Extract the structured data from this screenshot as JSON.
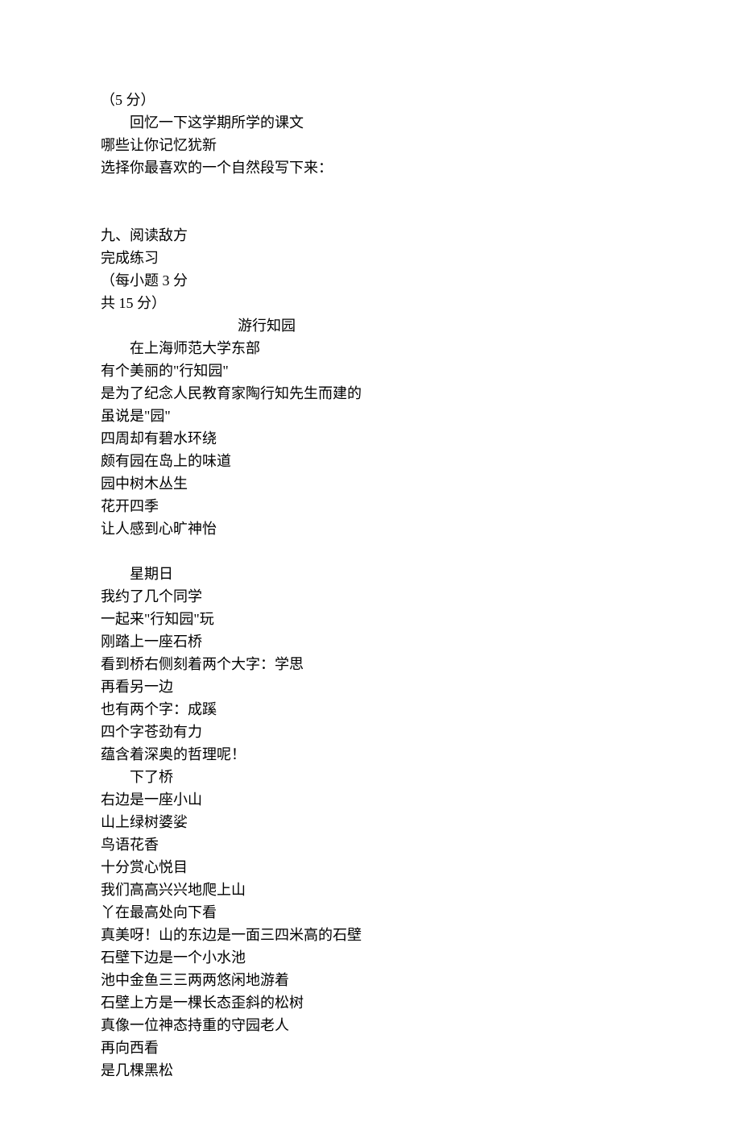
{
  "block1": {
    "l1": "（5 分）",
    "l2": "回忆一下这学期所学的课文",
    "l3": "哪些让你记忆犹新",
    "l4": "选择你最喜欢的一个自然段写下来："
  },
  "block2": {
    "l1": "九、阅读敌方",
    "l2": "完成练习",
    "l3": "（每小题 3 分",
    "l4": "共 15 分）",
    "title": "游行知园",
    "l5": "在上海师范大学东部",
    "l6": "有个美丽的\"行知园\"",
    "l7": "是为了纪念人民教育家陶行知先生而建的",
    "l8": "虽说是\"园\"",
    "l9": "四周却有碧水环绕",
    "l10": "颇有园在岛上的味道",
    "l11": "园中树木丛生",
    "l12": "花开四季",
    "l13": "让人感到心旷神怡"
  },
  "block3": {
    "l1": "星期日",
    "l2": "我约了几个同学",
    "l3": "一起来\"行知园\"玩",
    "l4": "刚踏上一座石桥",
    "l5": "看到桥右侧刻着两个大字：学思",
    "l6": "再看另一边",
    "l7": "也有两个字：成蹊",
    "l8": "四个字苍劲有力",
    "l9": "蕴含着深奥的哲理呢！",
    "l10": "下了桥",
    "l11": "右边是一座小山",
    "l12": "山上绿树婆娑",
    "l13": "鸟语花香",
    "l14": "十分赏心悦目",
    "l15": "我们高高兴兴地爬上山",
    "l16": "丫在最高处向下看",
    "l17": "真美呀！山的东边是一面三四米高的石壁",
    "l18": "石壁下边是一个小水池",
    "l19": "池中金鱼三三两两悠闲地游着",
    "l20": "石壁上方是一棵长态歪斜的松树",
    "l21": "真像一位神态持重的守园老人",
    "l22": "再向西看",
    "l23": "是几棵黑松"
  }
}
